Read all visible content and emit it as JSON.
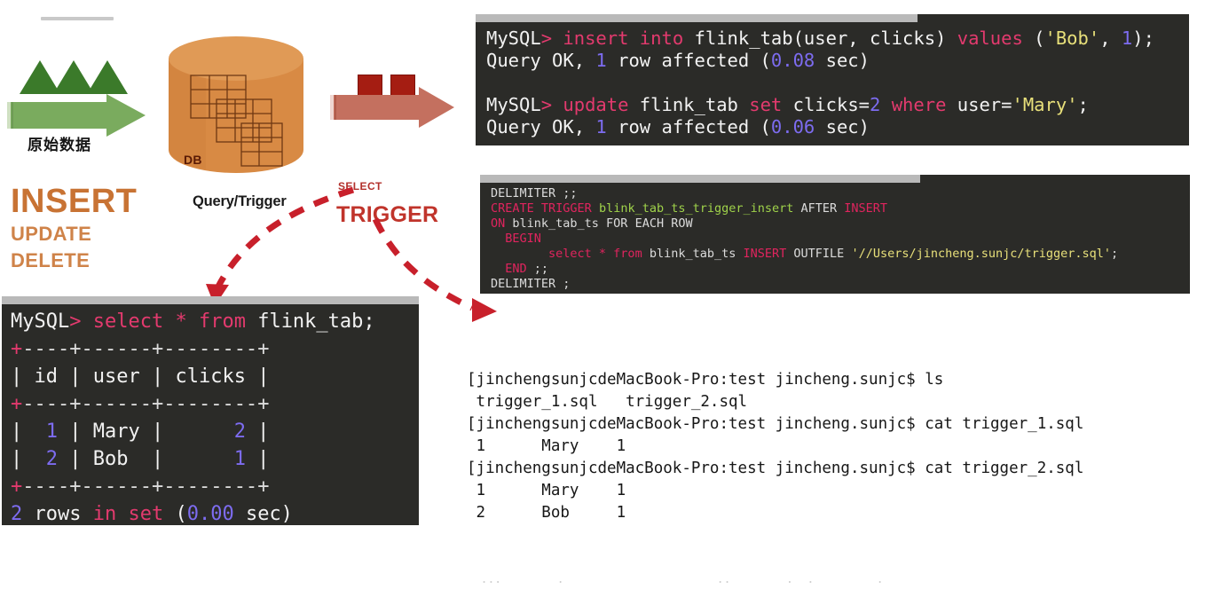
{
  "diagram": {
    "raw_data_label": "原始数据",
    "db_label": "DB",
    "query_trigger_label": "Query/Trigger",
    "select_label": "SELECT",
    "trigger_label": "TRIGGER",
    "dml": {
      "insert": "INSERT",
      "update": "UPDATE",
      "delete": "DELETE"
    },
    "colors": {
      "green_arrow": "#7aab5e",
      "green_triangle": "#3b7a2a",
      "red_arrow": "#c4705f",
      "red_square": "#a51d12",
      "db_cylinder": "#d88a44",
      "insert_text": "#c87334",
      "trigger_text": "#c0342b",
      "dashed_arrow": "#c8202b"
    }
  },
  "terminal_insert": {
    "lines": [
      {
        "segments": [
          {
            "text": "MySQL",
            "style": "wh"
          },
          {
            "text": ">",
            "style": "pl"
          },
          {
            "text": " ",
            "style": "wh"
          },
          {
            "text": "insert into",
            "style": "kw"
          },
          {
            "text": " flink_tab(user, clicks) ",
            "style": "wh"
          },
          {
            "text": "values",
            "style": "kw"
          },
          {
            "text": " (",
            "style": "wh"
          },
          {
            "text": "'Bob'",
            "style": "str"
          },
          {
            "text": ", ",
            "style": "wh"
          },
          {
            "text": "1",
            "style": "num"
          },
          {
            "text": ");",
            "style": "wh"
          }
        ]
      },
      {
        "segments": [
          {
            "text": "Query OK, ",
            "style": "wh"
          },
          {
            "text": "1",
            "style": "num"
          },
          {
            "text": " row affected (",
            "style": "wh"
          },
          {
            "text": "0.08",
            "style": "num"
          },
          {
            "text": " sec)",
            "style": "wh"
          }
        ]
      },
      {
        "segments": [
          {
            "text": " ",
            "style": "wh"
          }
        ]
      },
      {
        "segments": [
          {
            "text": "MySQL",
            "style": "wh"
          },
          {
            "text": ">",
            "style": "pl"
          },
          {
            "text": " ",
            "style": "wh"
          },
          {
            "text": "update",
            "style": "kw"
          },
          {
            "text": " flink_tab ",
            "style": "wh"
          },
          {
            "text": "set",
            "style": "kw"
          },
          {
            "text": " clicks=",
            "style": "wh"
          },
          {
            "text": "2",
            "style": "num"
          },
          {
            "text": " ",
            "style": "wh"
          },
          {
            "text": "where",
            "style": "kw"
          },
          {
            "text": " user=",
            "style": "wh"
          },
          {
            "text": "'Mary'",
            "style": "str"
          },
          {
            "text": ";",
            "style": "wh"
          }
        ]
      },
      {
        "segments": [
          {
            "text": "Query OK, ",
            "style": "wh"
          },
          {
            "text": "1",
            "style": "num"
          },
          {
            "text": " row affected (",
            "style": "wh"
          },
          {
            "text": "0.06",
            "style": "num"
          },
          {
            "text": " sec)",
            "style": "wh"
          }
        ]
      }
    ]
  },
  "terminal_trigger": {
    "lines": [
      {
        "segments": [
          {
            "text": "DELIMITER ;;",
            "style": "dim"
          }
        ]
      },
      {
        "segments": [
          {
            "text": "CREATE TRIGGER",
            "style": "kw2"
          },
          {
            "text": " ",
            "style": "wh"
          },
          {
            "text": "blink_tab_ts_trigger_insert",
            "style": "gr"
          },
          {
            "text": " AFTER ",
            "style": "dim"
          },
          {
            "text": "INSERT",
            "style": "kw2"
          }
        ]
      },
      {
        "segments": [
          {
            "text": "ON",
            "style": "kw2"
          },
          {
            "text": " blink_tab_ts FOR EACH ROW",
            "style": "dim"
          }
        ]
      },
      {
        "segments": [
          {
            "text": "  ",
            "style": "wh"
          },
          {
            "text": "BEGIN",
            "style": "kw2"
          }
        ]
      },
      {
        "segments": [
          {
            "text": "        ",
            "style": "wh"
          },
          {
            "text": "select * from",
            "style": "kw2"
          },
          {
            "text": " blink_tab_ts ",
            "style": "dim"
          },
          {
            "text": "INSERT",
            "style": "kw2"
          },
          {
            "text": " OUTFILE ",
            "style": "dim"
          },
          {
            "text": "'//Users/jincheng.sunjc/trigger.sql'",
            "style": "str"
          },
          {
            "text": ";",
            "style": "dim"
          }
        ]
      },
      {
        "segments": [
          {
            "text": "  ",
            "style": "wh"
          },
          {
            "text": "END",
            "style": "kw2"
          },
          {
            "text": " ;;",
            "style": "dim"
          }
        ]
      },
      {
        "segments": [
          {
            "text": "DELIMITER ;",
            "style": "dim"
          }
        ]
      }
    ]
  },
  "terminal_select": {
    "lines": [
      {
        "segments": [
          {
            "text": "MySQL",
            "style": "wh"
          },
          {
            "text": ">",
            "style": "pl"
          },
          {
            "text": " ",
            "style": "wh"
          },
          {
            "text": "select",
            "style": "kw"
          },
          {
            "text": " ",
            "style": "wh"
          },
          {
            "text": "*",
            "style": "kw"
          },
          {
            "text": " ",
            "style": "wh"
          },
          {
            "text": "from",
            "style": "kw"
          },
          {
            "text": " flink_tab;",
            "style": "wh"
          }
        ]
      },
      {
        "segments": [
          {
            "text": "+",
            "style": "kw"
          },
          {
            "text": "----",
            "style": "dim"
          },
          {
            "text": "+",
            "style": "dim"
          },
          {
            "text": "------",
            "style": "dim"
          },
          {
            "text": "+",
            "style": "dim"
          },
          {
            "text": "--------",
            "style": "dim"
          },
          {
            "text": "+",
            "style": "dim"
          }
        ]
      },
      {
        "segments": [
          {
            "text": "| ",
            "style": "wh"
          },
          {
            "text": "id",
            "style": "wh"
          },
          {
            "text": " | ",
            "style": "wh"
          },
          {
            "text": "user",
            "style": "wh"
          },
          {
            "text": " | ",
            "style": "wh"
          },
          {
            "text": "clicks",
            "style": "wh"
          },
          {
            "text": " |",
            "style": "wh"
          }
        ]
      },
      {
        "segments": [
          {
            "text": "+",
            "style": "kw"
          },
          {
            "text": "----",
            "style": "dim"
          },
          {
            "text": "+",
            "style": "dim"
          },
          {
            "text": "------",
            "style": "dim"
          },
          {
            "text": "+",
            "style": "dim"
          },
          {
            "text": "--------",
            "style": "dim"
          },
          {
            "text": "+",
            "style": "dim"
          }
        ]
      },
      {
        "segments": [
          {
            "text": "|  ",
            "style": "wh"
          },
          {
            "text": "1",
            "style": "num"
          },
          {
            "text": " | Mary |      ",
            "style": "wh"
          },
          {
            "text": "2",
            "style": "num"
          },
          {
            "text": " |",
            "style": "wh"
          }
        ]
      },
      {
        "segments": [
          {
            "text": "|  ",
            "style": "wh"
          },
          {
            "text": "2",
            "style": "num"
          },
          {
            "text": " | Bob  |      ",
            "style": "wh"
          },
          {
            "text": "1",
            "style": "num"
          },
          {
            "text": " |",
            "style": "wh"
          }
        ]
      },
      {
        "segments": [
          {
            "text": "+",
            "style": "kw"
          },
          {
            "text": "----",
            "style": "dim"
          },
          {
            "text": "+",
            "style": "dim"
          },
          {
            "text": "------",
            "style": "dim"
          },
          {
            "text": "+",
            "style": "dim"
          },
          {
            "text": "--------",
            "style": "dim"
          },
          {
            "text": "+",
            "style": "dim"
          }
        ]
      },
      {
        "segments": [
          {
            "text": "2",
            "style": "num"
          },
          {
            "text": " rows ",
            "style": "wh"
          },
          {
            "text": "in set",
            "style": "kw"
          },
          {
            "text": " (",
            "style": "wh"
          },
          {
            "text": "0.00",
            "style": "num"
          },
          {
            "text": " sec)",
            "style": "wh"
          }
        ]
      }
    ],
    "table": {
      "columns": [
        "id",
        "user",
        "clicks"
      ],
      "rows": [
        [
          "1",
          "Mary",
          "2"
        ],
        [
          "2",
          "Bob",
          "1"
        ]
      ],
      "footer": "2 rows in set (0.00 sec)"
    }
  },
  "shell": {
    "prompt": "jinchengsunjcdeMacBook-Pro:test jincheng.sunjc$",
    "lines": [
      "[jinchengsunjcdeMacBook-Pro:test jincheng.sunjc$ ls",
      " trigger_1.sql   trigger_2.sql",
      "[jinchengsunjcdeMacBook-Pro:test jincheng.sunjc$ cat trigger_1.sql",
      " 1      Mary    1",
      "[jinchengsunjcdeMacBook-Pro:test jincheng.sunjc$ cat trigger_2.sql",
      " 1      Mary    1",
      " 2      Bob     1"
    ],
    "commands": [
      "ls",
      "cat trigger_1.sql",
      "cat trigger_2.sql"
    ],
    "files": [
      "trigger_1.sql",
      "trigger_2.sql"
    ],
    "trigger_1_contents": [
      [
        "1",
        "Mary",
        "1"
      ]
    ],
    "trigger_2_contents": [
      [
        "1",
        "Mary",
        "1"
      ],
      [
        "2",
        "Bob",
        "1"
      ]
    ]
  }
}
